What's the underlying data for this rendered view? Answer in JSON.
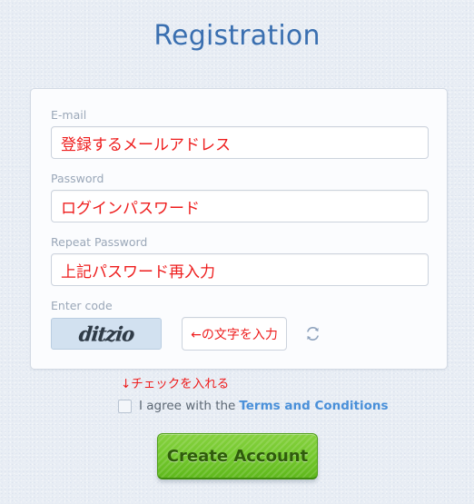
{
  "page": {
    "title": "Registration",
    "title_color": "#3a6fb0",
    "background_color": "#e8edf4"
  },
  "form": {
    "fields": [
      {
        "label": "E-mail",
        "value": "登録するメールアドレス",
        "value_color": "#ee1c1c"
      },
      {
        "label": "Password",
        "value": "ログインパスワード",
        "value_color": "#ee1c1c"
      },
      {
        "label": "Repeat Password",
        "value": "上記パスワード再入力",
        "value_color": "#ee1c1c"
      }
    ],
    "captcha": {
      "label": "Enter code",
      "image_text": "ditzio",
      "input_value": "←の文字を入力",
      "refresh_icon": "refresh-icon"
    }
  },
  "agreement": {
    "hint": "↓チェックを入れる",
    "hint_color": "#ee1c1c",
    "checkbox_checked": false,
    "text": "I agree with the",
    "link_label": "Terms and Conditions",
    "link_color": "#4a90d9"
  },
  "submit": {
    "label": "Create Account",
    "color": "#6dc62a"
  }
}
